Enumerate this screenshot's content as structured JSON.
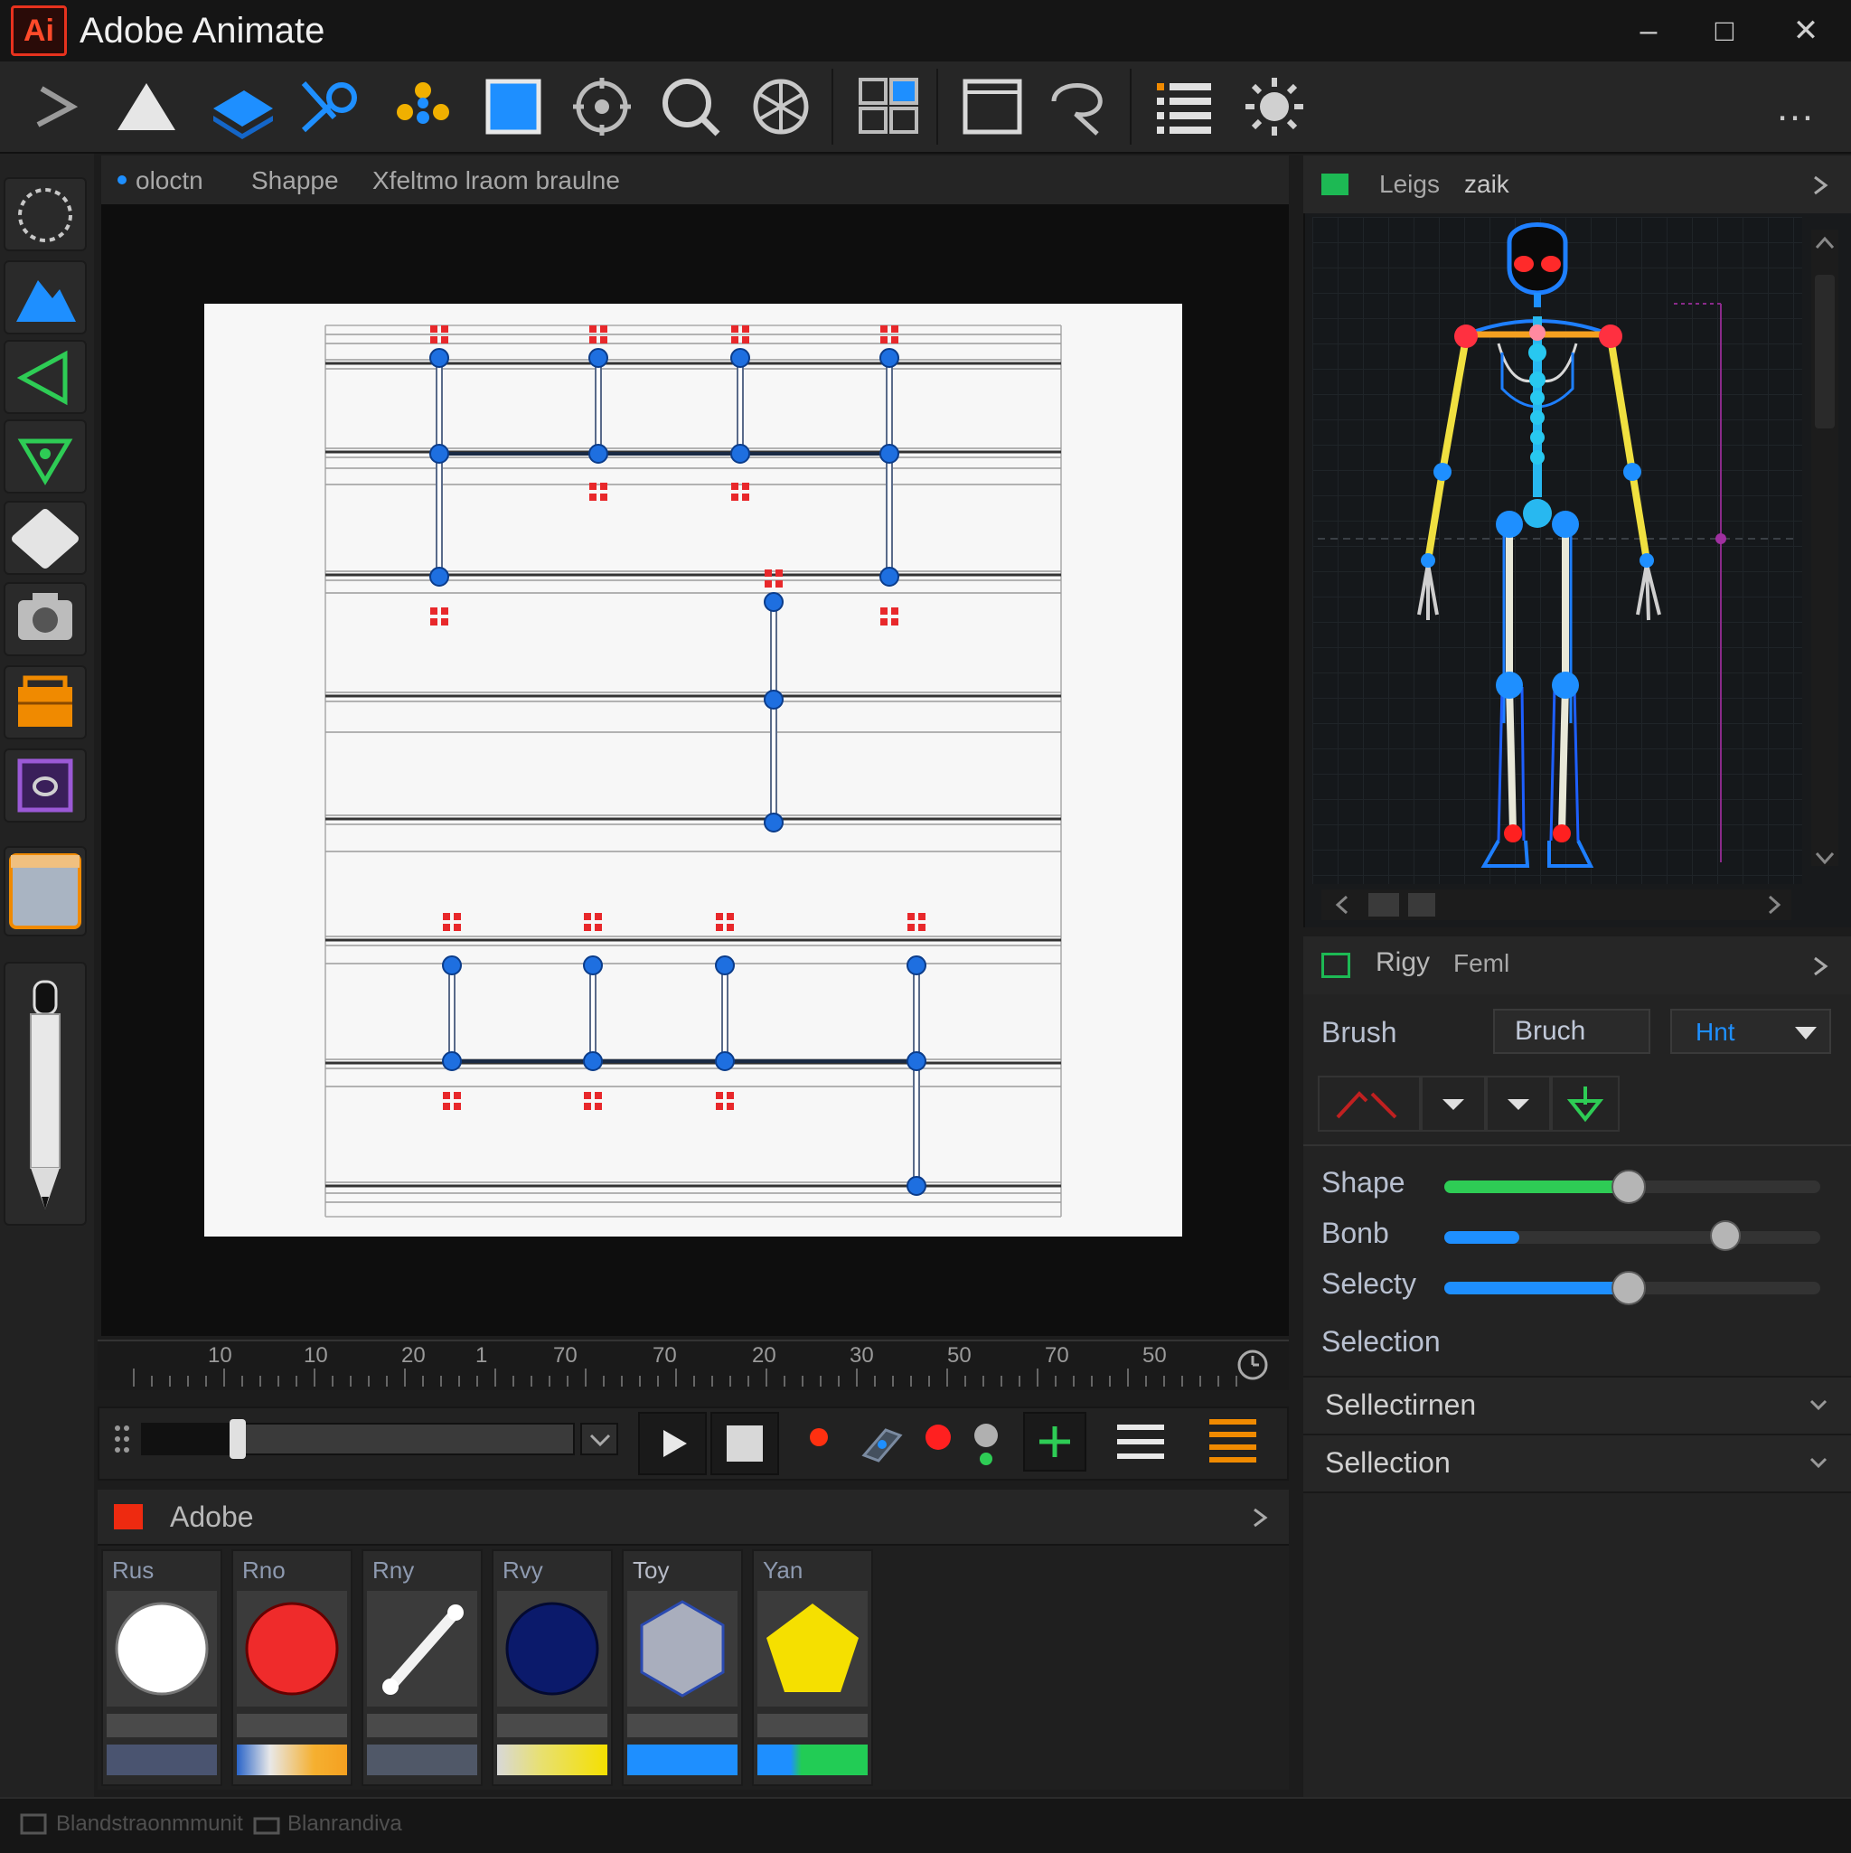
{
  "app": {
    "logo": "Ai",
    "title": "Adobe Animate"
  },
  "window": {
    "minimize": "–",
    "maximize": "□",
    "close": "✕"
  },
  "toolbar": {
    "icons": [
      "arrow-tool-icon",
      "triangle-tool-icon",
      "layer-tool-icon",
      "bone-link-icon",
      "nodes-icon",
      "rectangle-tool-icon",
      "target-icon",
      "magnifier-icon",
      "wheel-icon",
      "layout-panels-icon",
      "frame-icon",
      "lasso-icon",
      "list-icon",
      "settings-sun-icon"
    ],
    "more": "…"
  },
  "doc_tabs": [
    "oloctn",
    "Shappe",
    "Xfeltmo lraom braulne"
  ],
  "rig_panel": {
    "tabs": [
      "Leigs",
      "zaik"
    ],
    "accent": "#1db954"
  },
  "properties": {
    "tabs": [
      "Rigy",
      "Feml"
    ],
    "brush_label": "Brush",
    "brush_value": "Bruch",
    "brush_dropdown": "Hnt",
    "sliders": [
      {
        "label": "Shape",
        "value": 0.49,
        "color": "#2ecc55"
      },
      {
        "label": "Bonb",
        "value": 0.2,
        "color": "#1e8fff"
      },
      {
        "label": "Selecty",
        "value": 0.49,
        "color": "#1e8fff"
      }
    ],
    "section_label": "Selection",
    "accordions": [
      "Sellectirnen",
      "Sellection"
    ]
  },
  "timeline": {
    "ruler_labels": [
      "10",
      "10",
      "20",
      "1",
      "70",
      "70",
      "20",
      "30",
      "50",
      "70",
      "50"
    ],
    "scrub_position": 0.22
  },
  "library": {
    "title": "Adobe",
    "swatches": [
      {
        "label": "Rus",
        "shape": "circle",
        "color": "#ffffff"
      },
      {
        "label": "Rno",
        "shape": "circle",
        "color": "#ef2b2b"
      },
      {
        "label": "Rny",
        "shape": "line",
        "color": "#f2f2f2"
      },
      {
        "label": "Rvy",
        "shape": "circle",
        "color": "#0b1a6b"
      },
      {
        "label": "Toy",
        "shape": "hexagon",
        "color": "#a9aebd"
      },
      {
        "label": "Yan",
        "shape": "pentagon",
        "color": "#f5e000"
      }
    ]
  },
  "status": {
    "items": [
      "Blandstraonmmunit",
      "Blanrandiva"
    ]
  }
}
